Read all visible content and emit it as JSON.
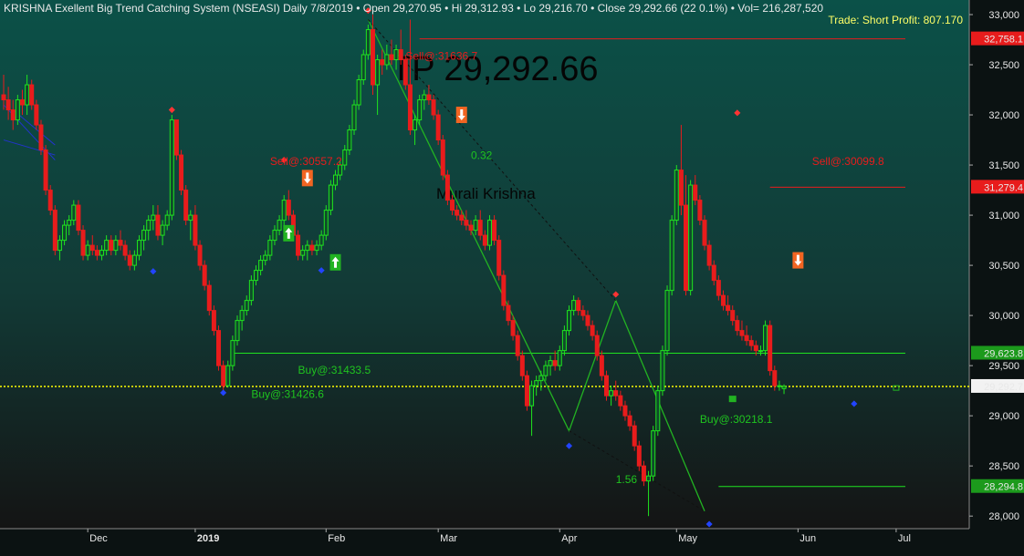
{
  "header": {
    "system": "KRISHNA Exellent Big Trend Catching System (NSEASI) Daily",
    "date": "7/8/2019",
    "open": "Open 29,270.95",
    "hi": "Hi 29,312.93",
    "lo": "Lo 29,216.70",
    "close": "Close 29,292.66 (22 0.1%)",
    "vol": "Vol= 216,287,520",
    "trade": "Trade: Short Profit:  807.170",
    "bullet": "•"
  },
  "watermark": {
    "big": "TP 29,292.66",
    "name": "Murali Krishna"
  },
  "colors": {
    "up": "#1fe31f",
    "down": "#e81c1c",
    "grid_bg_top": "#0b5148",
    "grid_bg_bottom": "#101010",
    "axis_text": "#e8e8e8",
    "close_line": "#ffff00"
  },
  "chart_data": {
    "type": "candlestick",
    "yrange": [
      27920,
      33100
    ],
    "yticks": [
      "28,000",
      "28,500",
      "29,000",
      "29,500",
      "30,000",
      "30,500",
      "31,000",
      "31,500",
      "32,000",
      "32,500",
      "33,000"
    ],
    "ytick_values": [
      28000,
      28500,
      29000,
      29500,
      30000,
      30500,
      31000,
      31500,
      32000,
      32500,
      33000
    ],
    "xticks": [
      {
        "label": "Dec",
        "bar": 18
      },
      {
        "label": "2019",
        "bar": 41
      },
      {
        "label": "Feb",
        "bar": 69
      },
      {
        "label": "Mar",
        "bar": 93
      },
      {
        "label": "Apr",
        "bar": 119
      },
      {
        "label": "May",
        "bar": 144
      },
      {
        "label": "Jun",
        "bar": 170
      },
      {
        "label": "Jul",
        "bar": 191
      }
    ],
    "candles": [
      [
        32200,
        32400,
        32050,
        32150
      ],
      [
        32150,
        32280,
        31950,
        32050
      ],
      [
        32050,
        32150,
        31850,
        31950
      ],
      [
        31950,
        32200,
        31900,
        32150
      ],
      [
        32150,
        32250,
        32000,
        32100
      ],
      [
        32100,
        32400,
        32000,
        32300
      ],
      [
        32300,
        32350,
        32050,
        32100
      ],
      [
        32100,
        32150,
        31850,
        31900
      ],
      [
        31900,
        31950,
        31600,
        31650
      ],
      [
        31650,
        31700,
        31200,
        31250
      ],
      [
        31250,
        31300,
        31000,
        31050
      ],
      [
        31050,
        31100,
        30600,
        30650
      ],
      [
        30650,
        30800,
        30550,
        30750
      ],
      [
        30750,
        30950,
        30700,
        30900
      ],
      [
        30900,
        31000,
        30800,
        30950
      ],
      [
        30950,
        31150,
        30900,
        31100
      ],
      [
        31100,
        31150,
        30800,
        30850
      ],
      [
        30850,
        30900,
        30550,
        30600
      ],
      [
        30600,
        30750,
        30550,
        30700
      ],
      [
        30700,
        30800,
        30600,
        30650
      ],
      [
        30650,
        30700,
        30550,
        30600
      ],
      [
        30600,
        30700,
        30550,
        30650
      ],
      [
        30650,
        30800,
        30600,
        30750
      ],
      [
        30750,
        30800,
        30600,
        30650
      ],
      [
        30650,
        30800,
        30600,
        30750
      ],
      [
        30750,
        30850,
        30650,
        30700
      ],
      [
        30700,
        30750,
        30550,
        30600
      ],
      [
        30600,
        30650,
        30450,
        30500
      ],
      [
        30500,
        30650,
        30450,
        30600
      ],
      [
        30600,
        30800,
        30550,
        30750
      ],
      [
        30750,
        30900,
        30650,
        30850
      ],
      [
        30850,
        31000,
        30750,
        30950
      ],
      [
        30950,
        31100,
        30850,
        31000
      ],
      [
        31000,
        31100,
        30750,
        30800
      ],
      [
        30800,
        30950,
        30700,
        30900
      ],
      [
        30900,
        31050,
        30850,
        31000
      ],
      [
        31000,
        32000,
        30950,
        31950
      ],
      [
        31950,
        31950,
        31550,
        31600
      ],
      [
        31600,
        31650,
        31200,
        31250
      ],
      [
        31250,
        31300,
        30900,
        30950
      ],
      [
        30950,
        31050,
        30750,
        31000
      ],
      [
        31000,
        31100,
        30650,
        30700
      ],
      [
        30700,
        30750,
        30450,
        30500
      ],
      [
        30500,
        30550,
        30250,
        30300
      ],
      [
        30300,
        30350,
        30000,
        30050
      ],
      [
        30050,
        30100,
        29800,
        29850
      ],
      [
        29850,
        29900,
        29450,
        29500
      ],
      [
        29500,
        29550,
        29250,
        29300
      ],
      [
        29300,
        29550,
        29280,
        29500
      ],
      [
        29500,
        29800,
        29450,
        29750
      ],
      [
        29750,
        30000,
        29700,
        29950
      ],
      [
        29950,
        30100,
        29850,
        30050
      ],
      [
        30050,
        30200,
        30000,
        30150
      ],
      [
        30150,
        30400,
        30100,
        30350
      ],
      [
        30350,
        30500,
        30300,
        30450
      ],
      [
        30450,
        30600,
        30400,
        30550
      ],
      [
        30550,
        30650,
        30500,
        30600
      ],
      [
        30600,
        30800,
        30550,
        30750
      ],
      [
        30750,
        30900,
        30700,
        30850
      ],
      [
        30850,
        31000,
        30800,
        30950
      ],
      [
        30950,
        31200,
        30900,
        31150
      ],
      [
        31150,
        31250,
        30950,
        31000
      ],
      [
        31000,
        31050,
        30750,
        30800
      ],
      [
        30800,
        30850,
        30550,
        30600
      ],
      [
        30600,
        30700,
        30550,
        30650
      ],
      [
        30650,
        30750,
        30550,
        30700
      ],
      [
        30700,
        30750,
        30600,
        30650
      ],
      [
        30650,
        30750,
        30600,
        30700
      ],
      [
        30700,
        30850,
        30650,
        30800
      ],
      [
        30800,
        31100,
        30750,
        31050
      ],
      [
        31050,
        31350,
        31000,
        31300
      ],
      [
        31300,
        31450,
        31250,
        31400
      ],
      [
        31400,
        31550,
        31350,
        31500
      ],
      [
        31500,
        31700,
        31450,
        31650
      ],
      [
        31650,
        31900,
        31600,
        31850
      ],
      [
        31850,
        32150,
        31800,
        32100
      ],
      [
        32100,
        32400,
        32050,
        32350
      ],
      [
        32350,
        32650,
        32300,
        32600
      ],
      [
        32600,
        32900,
        32550,
        32850
      ],
      [
        32850,
        33000,
        32200,
        32300
      ],
      [
        32300,
        32600,
        32000,
        32550
      ],
      [
        32550,
        32650,
        32400,
        32500
      ],
      [
        32500,
        32700,
        32450,
        32600
      ],
      [
        32600,
        32750,
        32500,
        32550
      ],
      [
        32550,
        32700,
        32450,
        32650
      ],
      [
        32650,
        32850,
        32500,
        32550
      ],
      [
        32550,
        32600,
        32250,
        32300
      ],
      [
        32300,
        32950,
        31800,
        31850
      ],
      [
        31850,
        32000,
        31700,
        31950
      ],
      [
        31950,
        32200,
        31900,
        32150
      ],
      [
        32150,
        32250,
        32050,
        32200
      ],
      [
        32200,
        32300,
        32100,
        32150
      ],
      [
        32150,
        32200,
        31950,
        32000
      ],
      [
        32000,
        32050,
        31700,
        31750
      ],
      [
        31750,
        31800,
        31350,
        31400
      ],
      [
        31400,
        31450,
        31100,
        31150
      ],
      [
        31150,
        31200,
        31000,
        31050
      ],
      [
        31050,
        31100,
        30950,
        31000
      ],
      [
        31000,
        31050,
        30900,
        30950
      ],
      [
        30950,
        31050,
        30850,
        30900
      ],
      [
        30900,
        30950,
        30800,
        30850
      ],
      [
        30850,
        31000,
        30800,
        30950
      ],
      [
        30950,
        31050,
        30750,
        30800
      ],
      [
        30800,
        30850,
        30650,
        30700
      ],
      [
        30700,
        31000,
        30650,
        30950
      ],
      [
        30950,
        31000,
        30700,
        30750
      ],
      [
        30750,
        30800,
        30350,
        30400
      ],
      [
        30400,
        30450,
        30050,
        30100
      ],
      [
        30100,
        30150,
        29900,
        29950
      ],
      [
        29950,
        30000,
        29750,
        29800
      ],
      [
        29800,
        29850,
        29550,
        29600
      ],
      [
        29600,
        29650,
        29350,
        29400
      ],
      [
        29400,
        29450,
        29050,
        29100
      ],
      [
        29100,
        29350,
        28800,
        29300
      ],
      [
        29300,
        29400,
        29200,
        29350
      ],
      [
        29350,
        29450,
        29250,
        29400
      ],
      [
        29400,
        29550,
        29350,
        29500
      ],
      [
        29500,
        29600,
        29400,
        29550
      ],
      [
        29550,
        29650,
        29450,
        29500
      ],
      [
        29500,
        29700,
        29450,
        29650
      ],
      [
        29650,
        29900,
        29600,
        29850
      ],
      [
        29850,
        30100,
        29800,
        30050
      ],
      [
        30050,
        30200,
        30000,
        30150
      ],
      [
        30150,
        30180,
        30000,
        30050
      ],
      [
        30050,
        30100,
        29950,
        30000
      ],
      [
        30000,
        30050,
        29850,
        29900
      ],
      [
        29900,
        29950,
        29750,
        29800
      ],
      [
        29800,
        29850,
        29550,
        29600
      ],
      [
        29600,
        29650,
        29350,
        29400
      ],
      [
        29400,
        29450,
        29150,
        29200
      ],
      [
        29200,
        29300,
        29100,
        29250
      ],
      [
        29250,
        29350,
        29150,
        29200
      ],
      [
        29200,
        29250,
        29050,
        29100
      ],
      [
        29100,
        29150,
        28950,
        29000
      ],
      [
        29000,
        29050,
        28850,
        28900
      ],
      [
        28900,
        28950,
        28650,
        28700
      ],
      [
        28700,
        28750,
        28450,
        28500
      ],
      [
        28500,
        28550,
        28300,
        28350
      ],
      [
        28350,
        28450,
        28000,
        28400
      ],
      [
        28400,
        28900,
        28350,
        28850
      ],
      [
        28850,
        29300,
        28800,
        29250
      ],
      [
        29250,
        29700,
        29200,
        29650
      ],
      [
        29650,
        30300,
        29600,
        30250
      ],
      [
        30250,
        31000,
        30200,
        30950
      ],
      [
        30950,
        31500,
        30900,
        31450
      ],
      [
        31450,
        31900,
        31000,
        31100
      ],
      [
        31100,
        31400,
        30200,
        30250
      ],
      [
        30250,
        31350,
        30200,
        31300
      ],
      [
        31300,
        31400,
        31100,
        31150
      ],
      [
        31150,
        31200,
        30900,
        30950
      ],
      [
        30950,
        31000,
        30650,
        30700
      ],
      [
        30700,
        30750,
        30450,
        30500
      ],
      [
        30500,
        30550,
        30300,
        30350
      ],
      [
        30350,
        30400,
        30150,
        30200
      ],
      [
        30200,
        30250,
        30050,
        30100
      ],
      [
        30100,
        30200,
        30000,
        30050
      ],
      [
        30050,
        30100,
        29900,
        29950
      ],
      [
        29950,
        30000,
        29800,
        29850
      ],
      [
        29850,
        29950,
        29750,
        29800
      ],
      [
        29800,
        29900,
        29700,
        29750
      ],
      [
        29750,
        29800,
        29650,
        29700
      ],
      [
        29700,
        29750,
        29600,
        29650
      ],
      [
        29650,
        29700,
        29600,
        29650
      ],
      [
        29650,
        29950,
        29600,
        29900
      ],
      [
        29900,
        29950,
        29400,
        29450
      ],
      [
        29450,
        29500,
        29250,
        29300
      ],
      [
        29300,
        29350,
        29250,
        29300
      ],
      [
        29270.95,
        29312.93,
        29216.7,
        29292.66
      ]
    ],
    "price_labels": [
      {
        "text": "32,758.1",
        "value": 32758,
        "color": "#e81c1c"
      },
      {
        "text": "31,279.4",
        "value": 31279,
        "color": "#e81c1c"
      },
      {
        "text": "29,623.8",
        "value": 29624,
        "color": "#1c9a1c"
      },
      {
        "text": "29,292.7",
        "value": 29292.66,
        "color": "#111111"
      },
      {
        "text": "28,294.8",
        "value": 28295,
        "color": "#1c9a1c"
      }
    ],
    "annotations": [
      {
        "text": "Sell@:31636.7",
        "color": "#e81c1c",
        "bar": 86,
        "value": 32550
      },
      {
        "text": "Sell@:30557.2",
        "color": "#e81c1c",
        "bar": 57,
        "value": 31500
      },
      {
        "text": "Sell@:30099.8",
        "color": "#e81c1c",
        "bar": 173,
        "value": 31500
      },
      {
        "text": "Buy@:31433.5",
        "color": "#1fc41f",
        "bar": 63,
        "value": 29420
      },
      {
        "text": "Buy@:31426.6",
        "color": "#1fc41f",
        "bar": 53,
        "value": 29180
      },
      {
        "text": "Buy@:30218.1",
        "color": "#1fc41f",
        "bar": 149,
        "value": 28930
      },
      {
        "text": "0.32",
        "color": "#1fc41f",
        "bar": 100,
        "value": 31560
      },
      {
        "text": "1.56",
        "color": "#1fc41f",
        "bar": 131,
        "value": 28330
      }
    ]
  }
}
